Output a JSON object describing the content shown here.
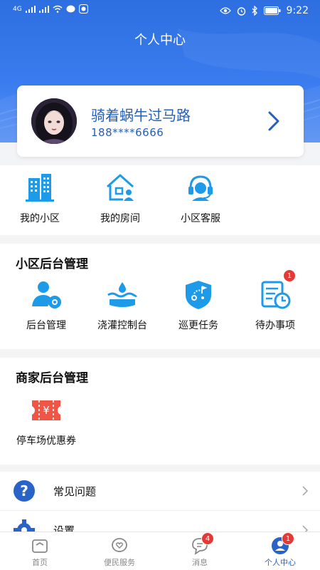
{
  "status_bar": {
    "time": "9:22",
    "network": "4G"
  },
  "header": {
    "title": "个人中心"
  },
  "profile": {
    "name": "骑着蜗牛过马路",
    "phone": "188****6666"
  },
  "quick_links": [
    {
      "label": "我的小区",
      "icon": "building-icon"
    },
    {
      "label": "我的房间",
      "icon": "house-person-icon"
    },
    {
      "label": "小区客服",
      "icon": "headset-icon"
    }
  ],
  "community_admin": {
    "title": "小区后台管理",
    "items": [
      {
        "label": "后台管理",
        "icon": "user-gear-icon",
        "badge": ""
      },
      {
        "label": "浇灌控制台",
        "icon": "water-drop-icon",
        "badge": ""
      },
      {
        "label": "巡更任务",
        "icon": "shield-patrol-icon",
        "badge": ""
      },
      {
        "label": "待办事项",
        "icon": "todo-clock-icon",
        "badge": "1"
      }
    ]
  },
  "merchant_admin": {
    "title": "商家后台管理",
    "items": [
      {
        "label": "停车场优惠券",
        "icon": "coupon-icon"
      }
    ]
  },
  "menu": [
    {
      "label": "常见问题",
      "icon": "question-icon"
    },
    {
      "label": "设置",
      "icon": "gear-icon"
    }
  ],
  "tabbar": [
    {
      "label": "首页",
      "icon": "home-icon",
      "badge": ""
    },
    {
      "label": "便民服务",
      "icon": "heart-chat-icon",
      "badge": ""
    },
    {
      "label": "消息",
      "icon": "message-icon",
      "badge": "4"
    },
    {
      "label": "个人中心",
      "icon": "person-icon",
      "badge": "1"
    }
  ],
  "colors": {
    "primary": "#2a63c7",
    "header": "#3b7df0",
    "accent_blue": "#1e9be8",
    "badge": "#e53935",
    "coupon": "#f05545"
  }
}
